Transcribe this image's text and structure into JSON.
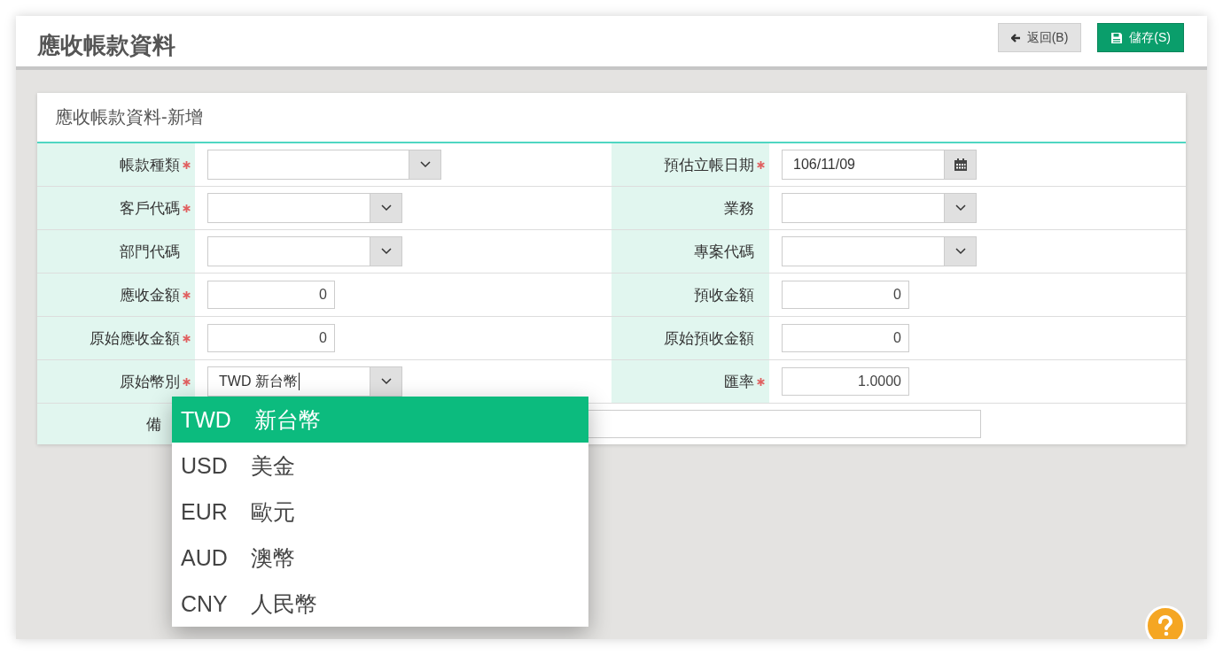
{
  "header": {
    "title": "應收帳款資料",
    "buttons": [
      {
        "kind": "back",
        "label": "返回(B)"
      },
      {
        "kind": "save",
        "label": "儲存(S)"
      }
    ]
  },
  "card": {
    "title": "應收帳款資料-新增",
    "rows": [
      [
        {
          "label": "帳款種類",
          "required": true,
          "kind": "select"
        },
        {
          "label": "預估立帳日期",
          "required": true,
          "kind": "date",
          "value": "106/11/09"
        }
      ],
      [
        {
          "label": "客戶代碼",
          "required": true,
          "kind": "select"
        },
        {
          "label": "業務",
          "required": false,
          "kind": "select"
        }
      ],
      [
        {
          "label": "部門代碼",
          "required": false,
          "kind": "select"
        },
        {
          "label": "專案代碼",
          "required": false,
          "kind": "select"
        }
      ],
      [
        {
          "label": "應收金額",
          "required": true,
          "kind": "number",
          "value": "0"
        },
        {
          "label": "預收金額",
          "required": false,
          "kind": "number",
          "value": "0"
        }
      ],
      [
        {
          "label": "原始應收金額",
          "required": true,
          "kind": "number",
          "value": "0"
        },
        {
          "label": "原始預收金額",
          "required": false,
          "kind": "number",
          "value": "0"
        }
      ],
      [
        {
          "label": "原始幣別",
          "required": true,
          "kind": "select",
          "value": "TWD 新台幣",
          "focused": true
        },
        {
          "label": "匯率",
          "required": true,
          "kind": "number",
          "value": "1.0000"
        }
      ]
    ],
    "remarks": {
      "label": "備",
      "required": false,
      "kind": "text"
    }
  },
  "dropdown": {
    "options": [
      {
        "code": "TWD",
        "name": "新台幣",
        "selected": true
      },
      {
        "code": "USD",
        "name": "美金",
        "selected": false
      },
      {
        "code": "EUR",
        "name": "歐元",
        "selected": false
      },
      {
        "code": "AUD",
        "name": "澳幣",
        "selected": false
      },
      {
        "code": "CNY",
        "name": "人民幣",
        "selected": false
      }
    ]
  }
}
